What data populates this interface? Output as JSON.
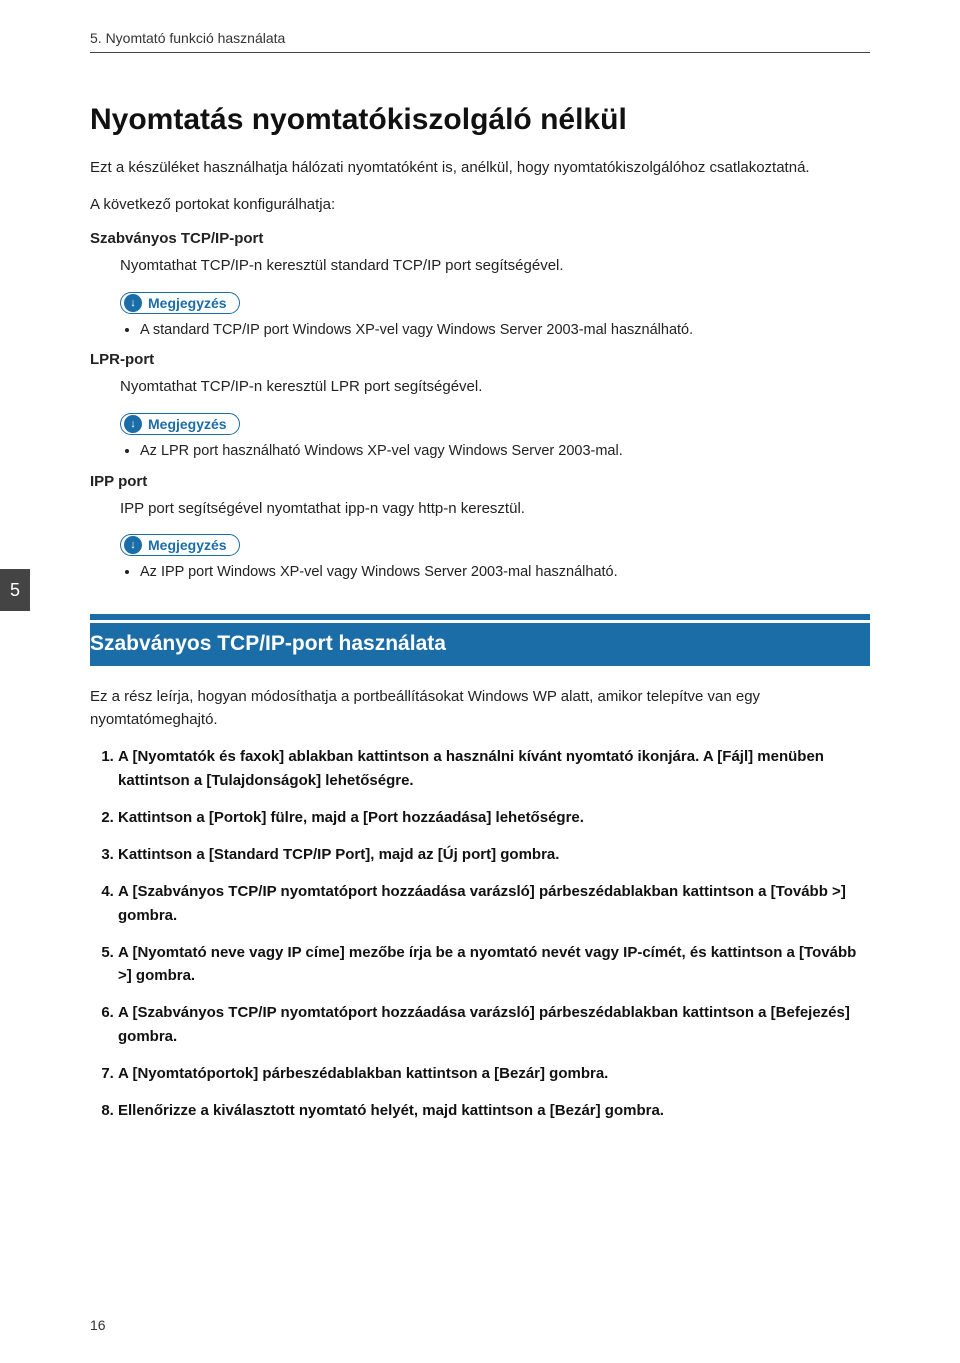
{
  "header": {
    "breadcrumb": "5. Nyomtató funkció használata"
  },
  "sideTab": "5",
  "title": "Nyomtatás nyomtatókiszolgáló nélkül",
  "intro": "Ezt a készüléket használhatja hálózati nyomtatóként is, anélkül, hogy nyomtatókiszolgálóhoz csatlakoztatná.",
  "configLine": "A következő portokat konfigurálhatja:",
  "noteLabel": "Megjegyzés",
  "ports": {
    "tcp": {
      "name": "Szabványos TCP/IP-port",
      "desc": "Nyomtathat TCP/IP-n keresztül standard TCP/IP port segítségével.",
      "note": "A standard TCP/IP port Windows XP-vel vagy Windows Server 2003-mal használható."
    },
    "lpr": {
      "name": "LPR-port",
      "desc": "Nyomtathat TCP/IP-n keresztül LPR port segítségével.",
      "note": "Az LPR port használható Windows XP-vel vagy Windows Server 2003-mal."
    },
    "ipp": {
      "name": "IPP port",
      "desc": "IPP port segítségével nyomtathat ipp-n vagy http-n keresztül.",
      "note": "Az IPP port Windows XP-vel vagy Windows Server 2003-mal használható."
    }
  },
  "section2": {
    "title": "Szabványos TCP/IP-port használata",
    "intro": "Ez a rész leírja, hogyan módosíthatja a portbeállításokat Windows WP alatt, amikor telepítve van egy nyomtatómeghajtó.",
    "steps": [
      "A [Nyomtatók és faxok] ablakban kattintson a használni kívánt nyomtató ikonjára. A [Fájl] menüben kattintson a [Tulajdonságok] lehetőségre.",
      "Kattintson a [Portok] fülre, majd a [Port hozzáadása] lehetőségre.",
      "Kattintson a [Standard TCP/IP Port], majd az [Új port] gombra.",
      "A [Szabványos TCP/IP nyomtatóport hozzáadása varázsló] párbeszédablakban kattintson a [Tovább >] gombra.",
      "A [Nyomtató neve vagy IP címe] mezőbe írja be a nyomtató nevét vagy IP-címét, és kattintson a [Tovább >] gombra.",
      "A [Szabványos TCP/IP nyomtatóport hozzáadása varázsló] párbeszédablakban kattintson a [Befejezés] gombra.",
      "A [Nyomtatóportok] párbeszédablakban kattintson a [Bezár] gombra.",
      "Ellenőrizze a kiválasztott nyomtató helyét, majd kattintson a [Bezár] gombra."
    ]
  },
  "pageNumber": "16"
}
